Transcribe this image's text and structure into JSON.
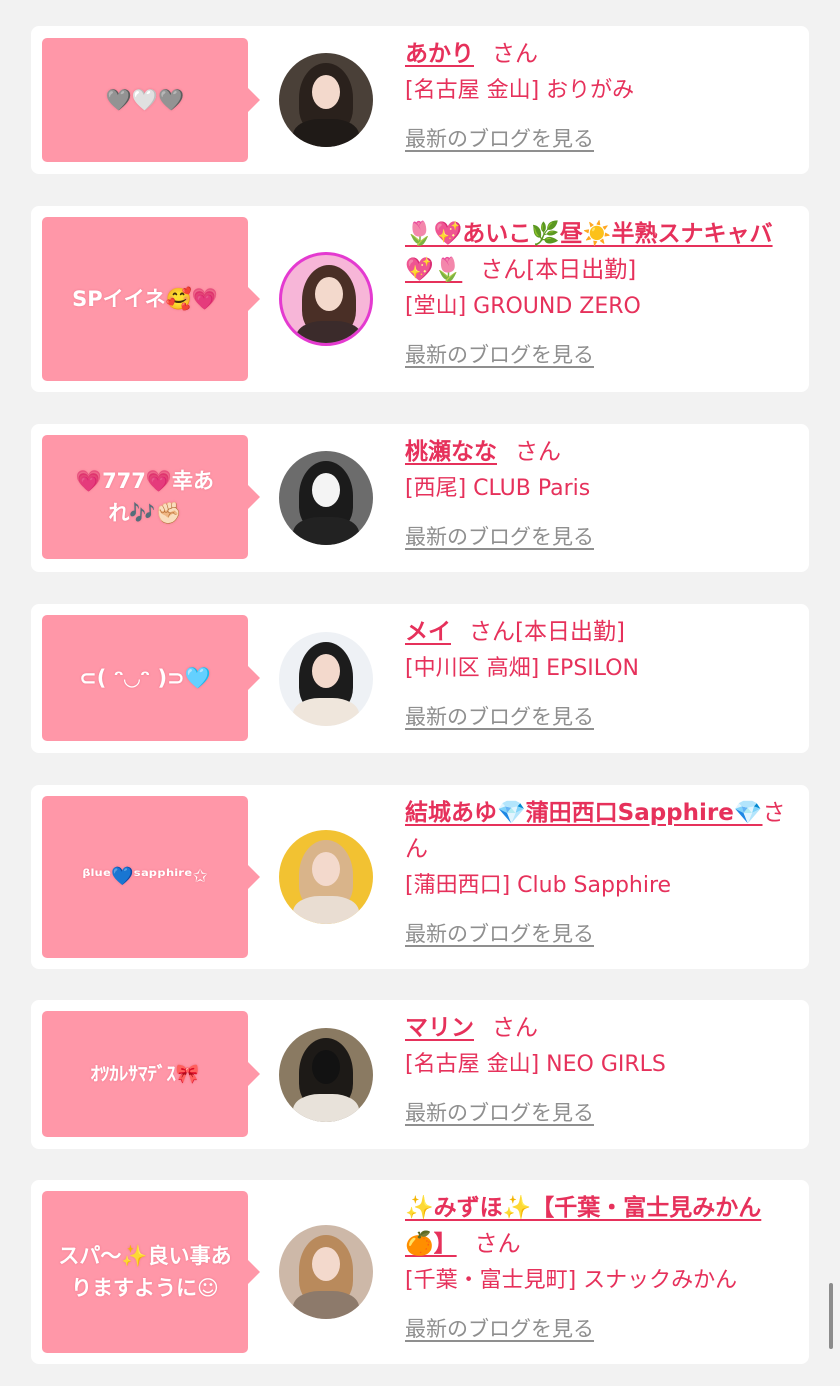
{
  "colors": {
    "background": "#f2f2f2",
    "card": "#ffffff",
    "bubble": "#ff97a8",
    "accent": "#e6315b",
    "blog_link": "#8f8f8f"
  },
  "entries": [
    {
      "message": "🩶🤍🩶",
      "name": "あかり",
      "honorific": "さん",
      "status": "",
      "shop": "[名古屋 金山] おりがみ",
      "blog_link": "最新のブログを見る",
      "avatar_icon": "user-photo-icon"
    },
    {
      "message": "SPイイネ🥰💗",
      "name": "🌷💖あいこ🌿昼☀️半熟スナキャバ💖🌷",
      "honorific": "さん",
      "status": "[本日出勤]",
      "shop": "[堂山] GROUND ZERO",
      "blog_link": "最新のブログを見る",
      "avatar_icon": "user-photo-icon"
    },
    {
      "message": "💗777💗幸あれ🎶✊🏻",
      "name": "桃瀬なな",
      "honorific": "さん",
      "status": "",
      "shop": "[西尾] CLUB Paris",
      "blog_link": "最新のブログを見る",
      "avatar_icon": "user-photo-icon"
    },
    {
      "message": "⊂( ᵔ◡ᵔ )⊃🩵",
      "name": "メイ",
      "honorific": "さん",
      "status": "[本日出勤]",
      "shop": "[中川区 高畑] EPSILON",
      "blog_link": "最新のブログを見る",
      "avatar_icon": "user-photo-icon"
    },
    {
      "message": "ᵝˡᵘᵉ💙ˢᵃᵖᵖʰⁱʳᵉ✩",
      "name": "結城あゆ💎蒲田西口Sapphire💎",
      "honorific": "さん",
      "status": "",
      "shop": "[蒲田西口] Club Sapphire",
      "blog_link": "最新のブログを見る",
      "avatar_icon": "user-photo-icon"
    },
    {
      "message": "ｵﾂｶﾚｻﾏﾃﾞｽ🎀",
      "name": "マリン",
      "honorific": "さん",
      "status": "",
      "shop": "[名古屋 金山] NEO GIRLS",
      "blog_link": "最新のブログを見る",
      "avatar_icon": "user-photo-icon"
    },
    {
      "message": "スパ〜✨良い事ありますように☺",
      "name": "✨みずほ✨【千葉・富士見みかん🍊】",
      "honorific": "さん",
      "status": "",
      "shop": "[千葉・富士見町] スナックみかん",
      "blog_link": "最新のブログを見る",
      "avatar_icon": "user-photo-icon"
    }
  ]
}
